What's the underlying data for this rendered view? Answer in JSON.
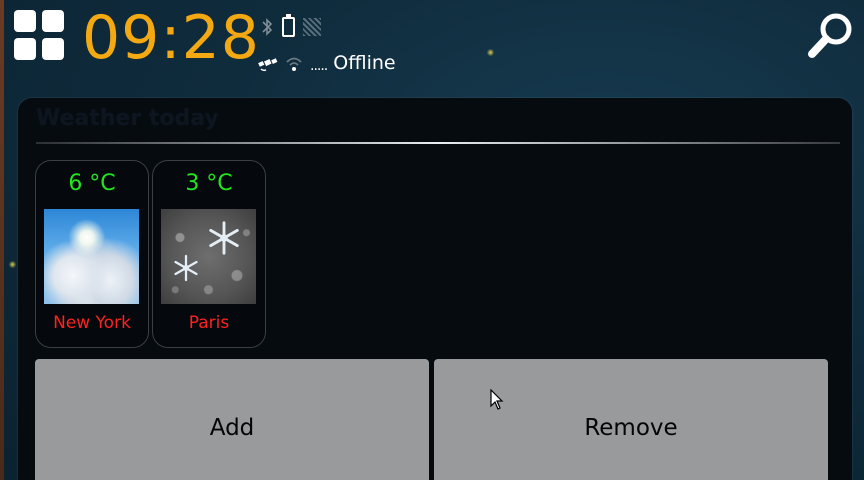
{
  "status_bar": {
    "time": "09:28",
    "network_status": "Offline",
    "network_dots": ".....",
    "icons": [
      "menu-grid-icon",
      "bluetooth-icon",
      "battery-icon",
      "signal-icon",
      "gps-icon",
      "wifi-icon",
      "search-icon"
    ]
  },
  "panel": {
    "title": "Weather today",
    "cities": [
      {
        "name": "New York",
        "temperature": "6 °C",
        "condition_icon": "partly-cloudy-icon"
      },
      {
        "name": "Paris",
        "temperature": "3 °C",
        "condition_icon": "snow-icon"
      }
    ]
  },
  "actions": {
    "add_label": "Add",
    "remove_label": "Remove"
  },
  "colors": {
    "clock": "#f4a812",
    "temperature": "#22e61c",
    "city_name": "#ff2020",
    "button": "#999a9c",
    "panel_bg": "#060b10"
  }
}
